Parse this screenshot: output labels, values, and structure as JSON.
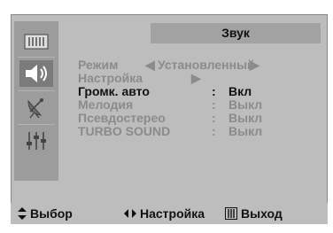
{
  "menu_title": "Звук",
  "sidebar": {
    "items": [
      {
        "icon": "picture-icon",
        "active": false
      },
      {
        "icon": "speaker-icon",
        "active": true
      },
      {
        "icon": "satellite-dish-icon",
        "active": false
      },
      {
        "icon": "equalizer-sliders-icon",
        "active": false
      }
    ]
  },
  "rows": [
    {
      "label": "Режим",
      "value": "Установленный",
      "left_arrow": "◀",
      "right_arrow": "▶",
      "state": "dim"
    },
    {
      "label": "Настройка",
      "value": "",
      "right_arrow": "▶",
      "state": "dim"
    },
    {
      "label": "Громк. авто",
      "colon": ":",
      "value": "Вкл",
      "state": "highlight"
    },
    {
      "label": "Мелодия",
      "colon": ":",
      "value": "Выкл",
      "state": "dim"
    },
    {
      "label": "Псевдостерео",
      "colon": ":",
      "value": "Выкл",
      "state": "dim"
    },
    {
      "label": "TURBO SOUND",
      "colon": ":",
      "value": "Выкл",
      "state": "dim"
    }
  ],
  "footer": {
    "select_label": "Выбор",
    "adjust_label": "Настройка",
    "exit_label": "Выход"
  },
  "colors": {
    "panel": "#bdbdbd",
    "sidebar": "#9c9c9c",
    "active": "#7b7b7b",
    "dim_text": "#8b8b8b",
    "text": "#111111"
  }
}
